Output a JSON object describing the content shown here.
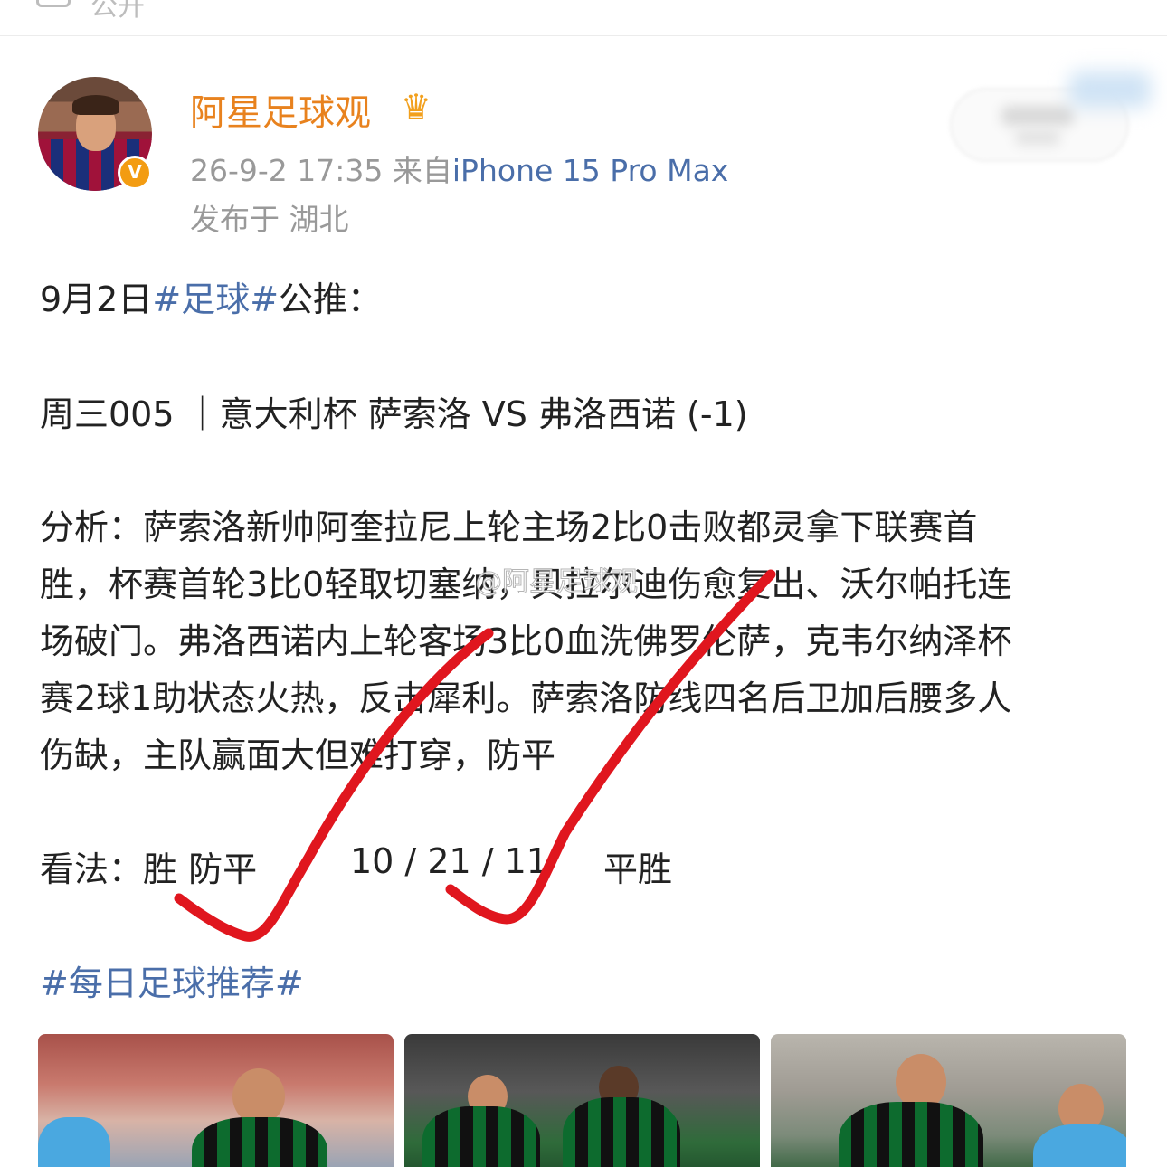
{
  "header_strip": {
    "label": "公开"
  },
  "author": {
    "name": "阿星足球观",
    "verified_badge": "V",
    "crown_icon": "crown-icon",
    "timestamp": "26-9-2 17:35",
    "source_prefix": "来自",
    "device": "iPhone 15 Pro Max",
    "location": "发布于 湖北"
  },
  "post": {
    "line1_pre": "9月2日",
    "line1_tag": "#足球#",
    "line1_post": "公推：",
    "match": "周三005 ｜意大利杯 萨索洛 VS 弗洛西诺 (-1)",
    "analysis_lines": [
      "分析：萨索洛新帅阿奎拉尼上轮主场2比0击败都灵拿下联赛首",
      "胜，杯赛首轮3比0轻取切塞纳，贝拉尔迪伤愈复出、沃尔帕托连",
      "场破门。弗洛西诺内上轮客场3比0血洗佛罗伦萨，克韦尔纳泽杯",
      "赛2球1助状态火热，反击犀利。萨索洛防线四名后卫加后腰多人",
      "伤缺，主队赢面大但难打穿，防平"
    ],
    "verdict_label": "看法：胜 防平",
    "verdict_score": "10 / 21 / 11",
    "verdict_result": "平胜",
    "hashtag": "#每日足球推荐#"
  },
  "watermark": "@阿星足球观",
  "annotation_color": "#e0161e",
  "colors": {
    "username": "#e8821e",
    "link": "#4a6ea9",
    "meta": "#999999"
  }
}
